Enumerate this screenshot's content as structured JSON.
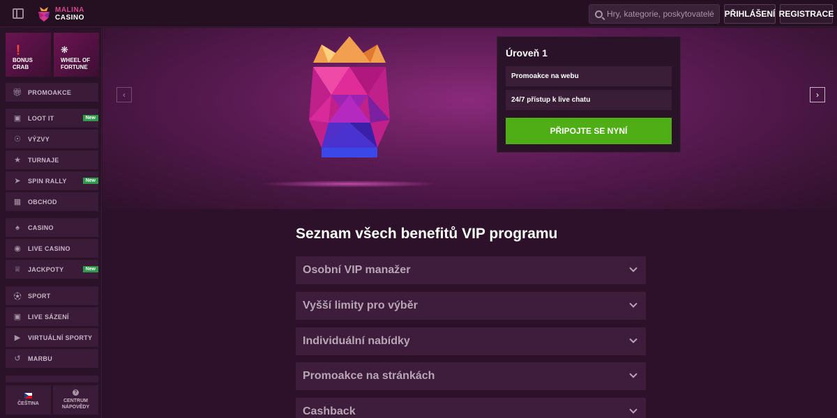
{
  "header": {
    "logo_line1": "MALINA",
    "logo_line2": "CASINO",
    "search_placeholder": "Hry, kategorie, poskytovatelé",
    "login_label": "PŘIHLÁŠENÍ",
    "register_label": "REGISTRACE"
  },
  "sidebar": {
    "tiles": [
      {
        "label": "BONUS CRAB",
        "icon": "crab-claw-icon"
      },
      {
        "label": "WHEEL OF FORTUNE",
        "icon": "wheel-icon"
      }
    ],
    "items": [
      {
        "label": "PROMOAKCE",
        "icon": "gift-icon",
        "badge": ""
      },
      {
        "label": "LOOT IT",
        "icon": "chest-icon",
        "badge": "New"
      },
      {
        "label": "VÝZVY",
        "icon": "medal-icon",
        "badge": ""
      },
      {
        "label": "TURNAJE",
        "icon": "trophy-icon",
        "badge": ""
      },
      {
        "label": "SPIN RALLY",
        "icon": "racer-icon",
        "badge": "New"
      },
      {
        "label": "OBCHOD",
        "icon": "shop-icon",
        "badge": ""
      },
      {
        "label": "CASINO",
        "icon": "cards-icon",
        "badge": ""
      },
      {
        "label": "LIVE CASINO",
        "icon": "chip-icon",
        "badge": ""
      },
      {
        "label": "JACKPOTY",
        "icon": "crown-icon",
        "badge": "New"
      },
      {
        "label": "SPORT",
        "icon": "ball-icon",
        "badge": ""
      },
      {
        "label": "LIVE SÁZENÍ",
        "icon": "live-icon",
        "badge": ""
      },
      {
        "label": "VIRTUÁLNÍ SPORTY",
        "icon": "virtual-icon",
        "badge": ""
      },
      {
        "label": "MARBU",
        "icon": "marbu-icon",
        "badge": ""
      }
    ],
    "bottom": {
      "language_label": "ČEŠTINA",
      "help_label": "CENTRUM NÁPOVĚDY"
    }
  },
  "level_card": {
    "title": "Úroveň 1",
    "benefits": [
      "Promoakce na webu",
      "24/7 přístup k live chatu"
    ],
    "join_label": "PŘIPOJTE SE NYNÍ"
  },
  "benefits": {
    "title": "Seznam všech benefitů VIP programu",
    "items": [
      "Osobní VIP manažer",
      "Vyšší limity pro výběr",
      "Individuální nabídky",
      "Promoakce na stránkách",
      "Cashback"
    ]
  },
  "colors": {
    "accent_green": "#4fae16",
    "brand_pink": "#d84590",
    "badge_green": "#2e9b4a"
  }
}
